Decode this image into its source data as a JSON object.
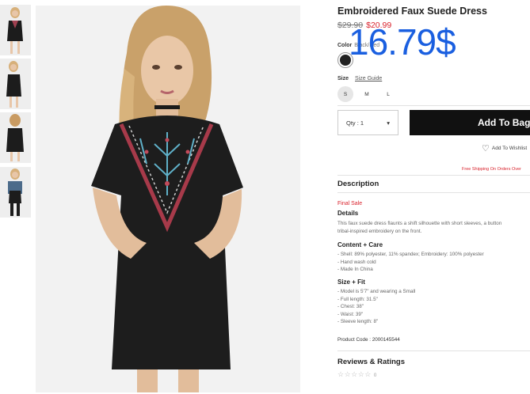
{
  "product": {
    "title": "Embroidered Faux Suede Dress",
    "old_price": "$29.90",
    "new_price": "$20.99",
    "overlay_price": "16.79$"
  },
  "color": {
    "label": "Color",
    "value": "Black/Red",
    "swatch_color": "#222222"
  },
  "size": {
    "label": "Size",
    "guide_link": "Size Guide",
    "options": [
      "S",
      "M",
      "L"
    ],
    "selected": "S"
  },
  "purchase": {
    "qty_label": "Qty : 1",
    "add_to_bag": "Add To Bag",
    "wishlist": "Add To Wishlist",
    "shipping_note": "Free Shipping On Orders Over"
  },
  "description": {
    "heading": "Description",
    "final_sale": "Final Sale",
    "details_heading": "Details",
    "details_lines": [
      "This faux suede dress flaunts a shift silhouette with short sleeves, a button",
      "tribal-inspired embroidery on the front."
    ],
    "content_heading": "Content + Care",
    "content_lines": [
      "- Shell: 89% polyester, 11% spandex; Embroidery: 100% polyester",
      "- Hand wash cold",
      "- Made In China"
    ],
    "size_fit_heading": "Size + Fit",
    "size_fit_lines": [
      "- Model is 5'7\" and wearing a Small",
      "- Full length: 31.5\"",
      "- Chest: 38\"",
      "- Waist: 39\"",
      "- Sleeve length: 8\""
    ],
    "product_code": "Product Code : 2000145544"
  },
  "reviews": {
    "heading": "Reviews & Ratings",
    "stars": "☆☆☆☆☆",
    "count": "0"
  },
  "colors": {
    "sale_red": "#d9232d",
    "overlay_blue": "#1a5fe0",
    "button_black": "#111111"
  }
}
